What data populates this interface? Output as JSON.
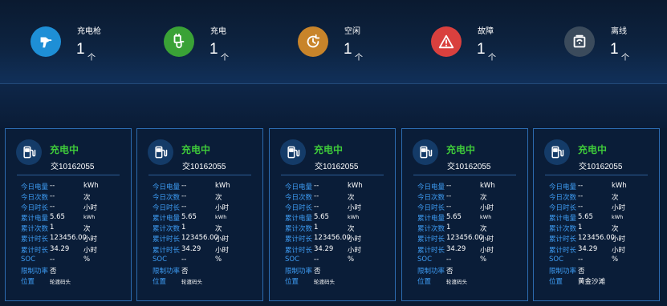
{
  "summary": [
    {
      "label": "充电枪",
      "count": "1",
      "unit": "个",
      "color": "#1e8fd6",
      "icon": "charging-gun-icon"
    },
    {
      "label": "充电",
      "count": "1",
      "unit": "个",
      "color": "#3aa236",
      "icon": "charging-plug-icon"
    },
    {
      "label": "空闲",
      "count": "1",
      "unit": "个",
      "color": "#c8842a",
      "icon": "clock-idle-icon"
    },
    {
      "label": "故障",
      "count": "1",
      "unit": "个",
      "color": "#d9403e",
      "icon": "warning-icon"
    },
    {
      "label": "离线",
      "count": "1",
      "unit": "个",
      "color": "#3b4b5c",
      "icon": "offline-charger-icon"
    }
  ],
  "cards": [
    {
      "status": "充电中",
      "code": "交10162055",
      "rows": [
        {
          "k": "今日电量",
          "v": "--",
          "u": "kWh"
        },
        {
          "k": "今日次数",
          "v": "--",
          "u": "次"
        },
        {
          "k": "今日时长",
          "v": "--",
          "u": "小时"
        },
        {
          "k": "累计电量",
          "v": "5.65",
          "u": "kWh"
        },
        {
          "k": "累计次数",
          "v": "1",
          "u": "次"
        },
        {
          "k": "累计时长",
          "v": "123456.00",
          "u": "小时"
        },
        {
          "k": "累计时长",
          "v": "34.29",
          "u": "小时"
        },
        {
          "k": "SOC",
          "v": "--",
          "u": "%"
        },
        {
          "k": "限制功率",
          "v": "否",
          "u": ""
        },
        {
          "k": "位置",
          "v": "轮渡码头",
          "u": ""
        }
      ]
    },
    {
      "status": "充电中",
      "code": "交10162055",
      "rows": [
        {
          "k": "今日电量",
          "v": "--",
          "u": "kWh"
        },
        {
          "k": "今日次数",
          "v": "--",
          "u": "次"
        },
        {
          "k": "今日时长",
          "v": "--",
          "u": "小时"
        },
        {
          "k": "累计电量",
          "v": "5.65",
          "u": "kWh"
        },
        {
          "k": "累计次数",
          "v": "1",
          "u": "次"
        },
        {
          "k": "累计时长",
          "v": "123456.00",
          "u": "小时"
        },
        {
          "k": "累计时长",
          "v": "34.29",
          "u": "小时"
        },
        {
          "k": "SOC",
          "v": "--",
          "u": "%"
        },
        {
          "k": "限制功率",
          "v": "否",
          "u": ""
        },
        {
          "k": "位置",
          "v": "轮渡码头",
          "u": ""
        }
      ]
    },
    {
      "status": "充电中",
      "code": "交10162055",
      "rows": [
        {
          "k": "今日电量",
          "v": "--",
          "u": "kWh"
        },
        {
          "k": "今日次数",
          "v": "--",
          "u": "次"
        },
        {
          "k": "今日时长",
          "v": "--",
          "u": "小时"
        },
        {
          "k": "累计电量",
          "v": "5.65",
          "u": "kWh"
        },
        {
          "k": "累计次数",
          "v": "1",
          "u": "次"
        },
        {
          "k": "累计时长",
          "v": "123456.00",
          "u": "小时"
        },
        {
          "k": "累计时长",
          "v": "34.29",
          "u": "小时"
        },
        {
          "k": "SOC",
          "v": "--",
          "u": "%"
        },
        {
          "k": "限制功率",
          "v": "否",
          "u": ""
        },
        {
          "k": "位置",
          "v": "轮渡码头",
          "u": ""
        }
      ]
    },
    {
      "status": "充电中",
      "code": "交10162055",
      "rows": [
        {
          "k": "今日电量",
          "v": "--",
          "u": "kWh"
        },
        {
          "k": "今日次数",
          "v": "--",
          "u": "次"
        },
        {
          "k": "今日时长",
          "v": "--",
          "u": "小时"
        },
        {
          "k": "累计电量",
          "v": "5.65",
          "u": "kWh"
        },
        {
          "k": "累计次数",
          "v": "1",
          "u": "次"
        },
        {
          "k": "累计时长",
          "v": "123456.00",
          "u": "小时"
        },
        {
          "k": "累计时长",
          "v": "34.29",
          "u": "小时"
        },
        {
          "k": "SOC",
          "v": "--",
          "u": "%"
        },
        {
          "k": "限制功率",
          "v": "否",
          "u": ""
        },
        {
          "k": "位置",
          "v": "轮渡码头",
          "u": ""
        }
      ]
    },
    {
      "status": "充电中",
      "code": "交10162055",
      "rows": [
        {
          "k": "今日电量",
          "v": "--",
          "u": "kWh"
        },
        {
          "k": "今日次数",
          "v": "--",
          "u": "次"
        },
        {
          "k": "今日时长",
          "v": "--",
          "u": "小时"
        },
        {
          "k": "累计电量",
          "v": "5.65",
          "u": "kWh"
        },
        {
          "k": "累计次数",
          "v": "1",
          "u": "次"
        },
        {
          "k": "累计时长",
          "v": "123456.00",
          "u": "小时"
        },
        {
          "k": "累计时长",
          "v": "34.29",
          "u": "小时"
        },
        {
          "k": "SOC",
          "v": "--",
          "u": "%"
        },
        {
          "k": "限制功率",
          "v": "否",
          "u": ""
        },
        {
          "k": "位置",
          "v": "黄金沙滩",
          "u": ""
        }
      ]
    }
  ]
}
